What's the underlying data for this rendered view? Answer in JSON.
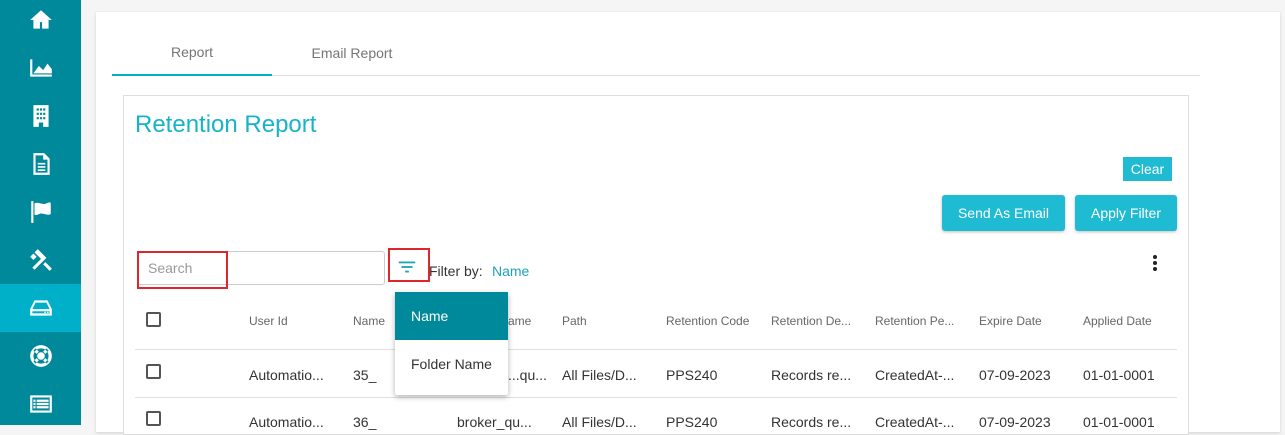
{
  "sidebar": {
    "items": [
      {
        "icon": "home-icon",
        "active": false
      },
      {
        "icon": "area-chart-icon",
        "active": false
      },
      {
        "icon": "building-icon",
        "active": false
      },
      {
        "icon": "document-icon",
        "active": false
      },
      {
        "icon": "flag-icon",
        "active": false
      },
      {
        "icon": "gavel-icon",
        "active": false
      },
      {
        "icon": "hard-drive-icon",
        "active": true
      },
      {
        "icon": "lifebuoy-icon",
        "active": false
      },
      {
        "icon": "list-icon",
        "active": false
      }
    ]
  },
  "tabs": [
    {
      "label": "Report",
      "active": true
    },
    {
      "label": "Email Report",
      "active": false
    }
  ],
  "report": {
    "title": "Retention Report",
    "clear_label": "Clear",
    "send_email_label": "Send As Email",
    "apply_filter_label": "Apply Filter",
    "search_placeholder": "Search",
    "filter_by_label": "Filter by:",
    "filter_by_value": "Name"
  },
  "filter_menu": {
    "options": [
      "Name",
      "Folder Name"
    ],
    "selected": "Name"
  },
  "table": {
    "columns": [
      "User Id",
      "Name",
      "Folder Name",
      "Path",
      "Retention Code",
      "Retention De...",
      "Retention Pe...",
      "Expire Date",
      "Applied Date"
    ],
    "header_partial_folder": "ame",
    "rows": [
      [
        "Automatio...",
        "35_",
        "...qu...",
        "All Files/D...",
        "PPS240",
        "Records re...",
        "CreatedAt-...",
        "07-09-2023",
        "01-01-0001"
      ],
      [
        "Automatio...",
        "36_",
        "broker_qu...",
        "All Files/D...",
        "PPS240",
        "Records re...",
        "CreatedAt-...",
        "07-09-2023",
        "01-01-0001"
      ]
    ]
  },
  "colors": {
    "sidebar": "#00899a",
    "sidebar_active": "#00b0c8",
    "accent": "#1ebbd3",
    "title": "#17b3c9",
    "highlight_box": "#e0262d"
  }
}
